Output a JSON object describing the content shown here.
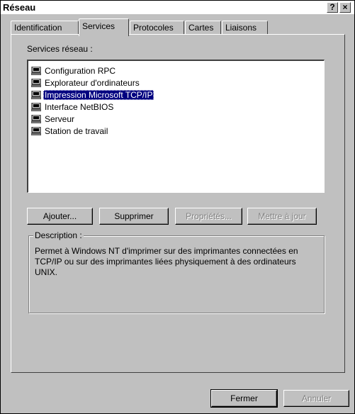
{
  "window": {
    "title": "Réseau",
    "help_button": "?",
    "close_button": "×"
  },
  "tabs": [
    {
      "label": "Identification",
      "active": false
    },
    {
      "label": "Services",
      "active": true
    },
    {
      "label": "Protocoles",
      "active": false
    },
    {
      "label": "Cartes",
      "active": false
    },
    {
      "label": "Liaisons",
      "active": false
    }
  ],
  "services": {
    "label": "Services réseau :",
    "items": [
      {
        "label": "Configuration RPC",
        "icon": "computer-icon",
        "selected": false
      },
      {
        "label": "Explorateur d'ordinateurs",
        "icon": "computer-icon",
        "selected": false
      },
      {
        "label": "Impression Microsoft TCP/IP",
        "icon": "computer-icon",
        "selected": true
      },
      {
        "label": "Interface NetBIOS",
        "icon": "computer-icon",
        "selected": false
      },
      {
        "label": "Serveur",
        "icon": "computer-icon",
        "selected": false
      },
      {
        "label": "Station de travail",
        "icon": "computer-icon",
        "selected": false
      }
    ]
  },
  "buttons": {
    "add": "Ajouter...",
    "remove": "Supprimer",
    "properties": "Propriétés...",
    "update": "Mettre à jour"
  },
  "description": {
    "legend": "Description :",
    "text": "Permet à Windows NT d'imprimer sur des imprimantes connectées en TCP/IP ou sur des imprimantes liées physiquement à des ordinateurs UNIX."
  },
  "footer": {
    "close": "Fermer",
    "cancel": "Annuler"
  },
  "colors": {
    "face": "#c0c0c0",
    "selection": "#000080"
  }
}
